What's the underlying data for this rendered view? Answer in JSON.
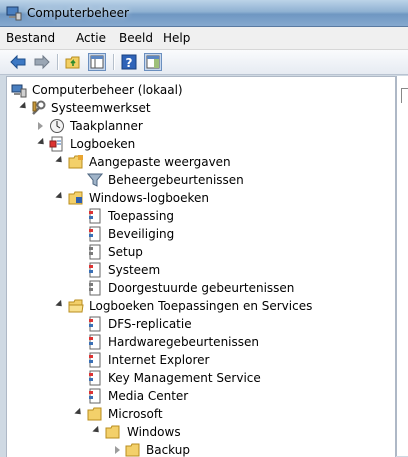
{
  "window": {
    "title": "Computerbeheer"
  },
  "menu": [
    "Bestand",
    "Actie",
    "Beeld",
    "Help"
  ],
  "toolbar": [
    "back-arrow-icon",
    "forward-arrow-icon",
    "up-folder-icon",
    "show-hide-tree-icon",
    "help-icon",
    "show-hide-action-pane-icon"
  ],
  "tree": {
    "root": "Computerbeheer (lokaal)",
    "systeemwerkset": "Systeemwerkset",
    "taakplanner": "Taakplanner",
    "logboeken": "Logboeken",
    "aangepaste": "Aangepaste weergaven",
    "beheergebeurtenissen": "Beheergebeurtenissen",
    "windows_logboeken": "Windows-logboeken",
    "toepassing": "Toepassing",
    "beveiliging": "Beveiliging",
    "setup": "Setup",
    "systeem": "Systeem",
    "doorgestuurde": "Doorgestuurde gebeurtenissen",
    "toepassingen_services": "Logboeken Toepassingen en Services",
    "dfs": "DFS-replicatie",
    "hardware": "Hardwaregebeurtenissen",
    "ie": "Internet Explorer",
    "kms": "Key Management Service",
    "media_center": "Media Center",
    "microsoft": "Microsoft",
    "windows": "Windows",
    "backup": "Backup"
  }
}
